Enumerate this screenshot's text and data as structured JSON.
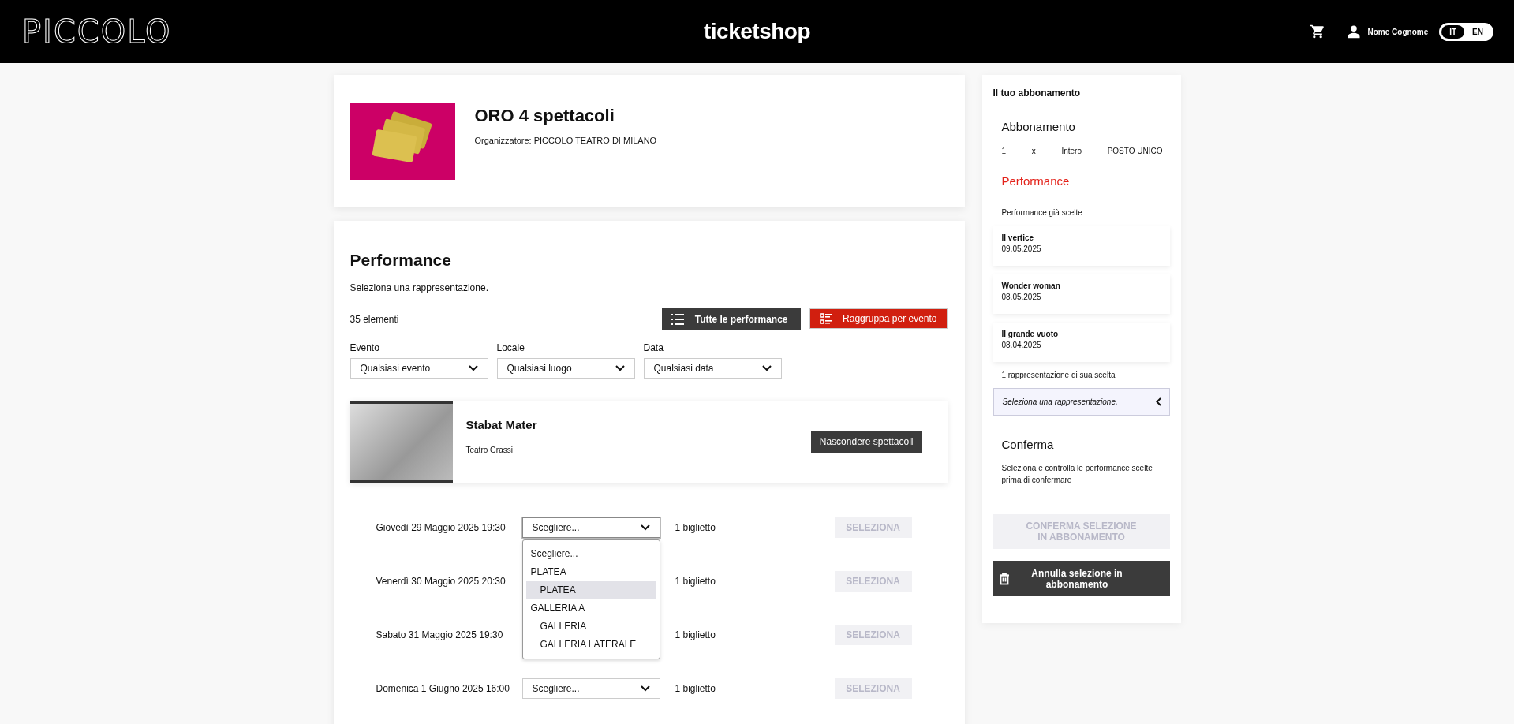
{
  "header": {
    "logo": "PICCOLO",
    "title": "ticketshop",
    "user": "Nome Cognome",
    "languages": [
      {
        "label": "IT",
        "selected": true
      },
      {
        "label": "EN",
        "selected": false
      }
    ]
  },
  "product": {
    "title": "ORO 4 spettacoli",
    "organizer": "Organizzatore: PICCOLO TEATRO DI MILANO"
  },
  "performance": {
    "heading": "Performance",
    "subtitle": "Seleziona una rappresentazione.",
    "count": "35 elementi",
    "view_buttons": [
      {
        "label": "Tutte le performance",
        "selected": false,
        "kind": "list"
      },
      {
        "label": "Raggruppa per evento",
        "selected": true,
        "kind": "group"
      }
    ],
    "filters": [
      {
        "label": "Evento",
        "value": "Qualsiasi evento"
      },
      {
        "label": "Locale",
        "value": "Qualsiasi luogo"
      },
      {
        "label": "Data",
        "value": "Qualsiasi data"
      }
    ],
    "event": {
      "title": "Stabat Mater",
      "venue": "Teatro Grassi",
      "button": "Nascondere spettacoli"
    },
    "rows": [
      {
        "date": "Giovedì 29 Maggio 2025 19:30",
        "select": "Scegliere...",
        "expanded": true,
        "tickets": "1 biglietto",
        "button": "SELEZIONA",
        "disabled": true,
        "options": [
          {
            "label": "Scegliere...",
            "selected": false
          },
          {
            "label": "PLATEA",
            "children": [
              {
                "label": "PLATEA",
                "selected": true
              }
            ]
          },
          {
            "label": "GALLERIA A",
            "children": [
              {
                "label": "GALLERIA",
                "selected": false
              },
              {
                "label": "GALLERIA LATERALE",
                "selected": false
              }
            ]
          }
        ]
      },
      {
        "date": "Venerdì 30 Maggio 2025 20:30",
        "tickets": "1 biglietto",
        "button": "SELEZIONA",
        "disabled": true
      },
      {
        "date": "Sabato 31 Maggio 2025 19:30",
        "tickets": "1 biglietto",
        "button": "SELEZIONA",
        "disabled": true
      },
      {
        "date": "Domenica 1 Giugno 2025 16:00",
        "select": "Scegliere...",
        "expanded": false,
        "tickets": "1 biglietto",
        "button": "SELEZIONA",
        "disabled": true
      }
    ]
  },
  "sidebar": {
    "title": "Il tuo abbonamento",
    "subscription_heading": "Abbonamento",
    "line": [
      "1",
      "x",
      "Intero",
      "POSTO UNICO"
    ],
    "performance_heading": "Performance",
    "chosen_label": "Performance già scelte",
    "chosen": [
      {
        "title": "Il vertice",
        "date": "09.05.2025"
      },
      {
        "title": "Wonder woman",
        "date": "08.05.2025"
      },
      {
        "title": "Il grande vuoto",
        "date": "08.04.2025"
      }
    ],
    "remaining": "1 rappresentazione di sua scelta",
    "slot": "Seleziona una rappresentazione.",
    "confirm_heading": "Conferma",
    "confirm_text": "Seleziona e controlla le performance scelte prima di confermare",
    "confirm_button": {
      "label": "CONFERMA SELEZIONE IN ABBONAMENTO",
      "disabled": true
    },
    "cancel_button": "Annulla selezione in abbonamento"
  }
}
